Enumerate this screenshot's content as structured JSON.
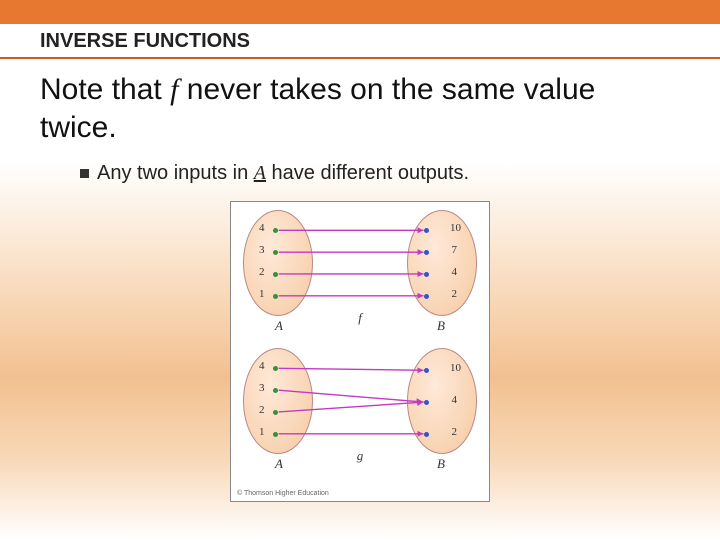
{
  "header": {
    "title": "INVERSE FUNCTIONS"
  },
  "main": {
    "pre": "Note that ",
    "f": "f",
    "post": " never takes on the same value twice."
  },
  "bullet": {
    "pre": "Any two inputs in ",
    "a": "A",
    "post": " have different outputs."
  },
  "diagram": {
    "credit": "© Thomson Higher Education",
    "top": {
      "domainLabel": "A",
      "rangeLabel": "B",
      "funcLabel": "f",
      "domain": [
        "4",
        "3",
        "2",
        "1"
      ],
      "range": [
        "10",
        "7",
        "4",
        "2"
      ]
    },
    "bottom": {
      "domainLabel": "A",
      "rangeLabel": "B",
      "funcLabel": "g",
      "domain": [
        "4",
        "3",
        "2",
        "1"
      ],
      "range": [
        "10",
        "4",
        "2"
      ]
    }
  },
  "chart_data": [
    {
      "type": "table",
      "title": "Function f: A → B (one-to-one)",
      "domain_set": "A",
      "range_set": "B",
      "mapping": [
        {
          "input": 4,
          "output": 10
        },
        {
          "input": 3,
          "output": 7
        },
        {
          "input": 2,
          "output": 4
        },
        {
          "input": 1,
          "output": 2
        }
      ]
    },
    {
      "type": "table",
      "title": "Function g: A → B (not one-to-one)",
      "domain_set": "A",
      "range_set": "B",
      "mapping": [
        {
          "input": 4,
          "output": 10
        },
        {
          "input": 3,
          "output": 4
        },
        {
          "input": 2,
          "output": 4
        },
        {
          "input": 1,
          "output": 2
        }
      ]
    }
  ]
}
